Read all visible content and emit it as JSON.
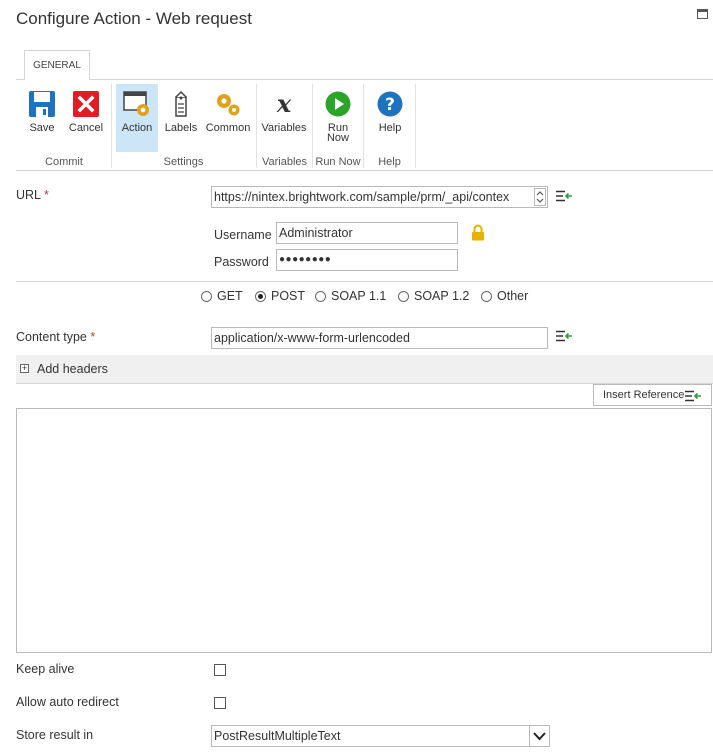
{
  "dialog": {
    "title": "Configure Action - Web request"
  },
  "ribbon": {
    "tab": "GENERAL",
    "buttons": {
      "save": "Save",
      "cancel": "Cancel",
      "action": "Action",
      "labels": "Labels",
      "common": "Common",
      "variables": "Variables",
      "run_now_1": "Run",
      "run_now_2": "Now",
      "help": "Help"
    },
    "groups": {
      "commit": "Commit",
      "settings": "Settings",
      "variables": "Variables",
      "run_now": "Run Now",
      "help": "Help"
    }
  },
  "form": {
    "url_label": "URL",
    "required_mark": "*",
    "url_value": "https://nintex.brightwork.com/sample/prm/_api/contex",
    "username_label": "Username",
    "username_value": "Administrator",
    "password_label": "Password",
    "password_value": "●●●●●●●●",
    "methods": [
      "GET",
      "POST",
      "SOAP 1.1",
      "SOAP 1.2",
      "Other"
    ],
    "selected_method": "POST",
    "content_type_label": "Content type",
    "content_type_value": "application/x-www-form-urlencoded",
    "add_headers_label": "Add headers",
    "insert_reference_label": "Insert Reference",
    "keep_alive_label": "Keep alive",
    "allow_redirect_label": "Allow auto redirect",
    "store_result_label": "Store result in",
    "store_result_value": "PostResultMultipleText"
  },
  "colors": {
    "save_icon": "#1e73be",
    "cancel_icon": "#e31b23",
    "run_icon": "#2aa52a",
    "help_icon": "#1e73be",
    "gear_icon": "#e0a21a",
    "active_button_bg": "#cde6f7",
    "required": "#c0392b",
    "lock_icon": "#e8b100",
    "insert_icon_green": "#2e9e3c"
  }
}
